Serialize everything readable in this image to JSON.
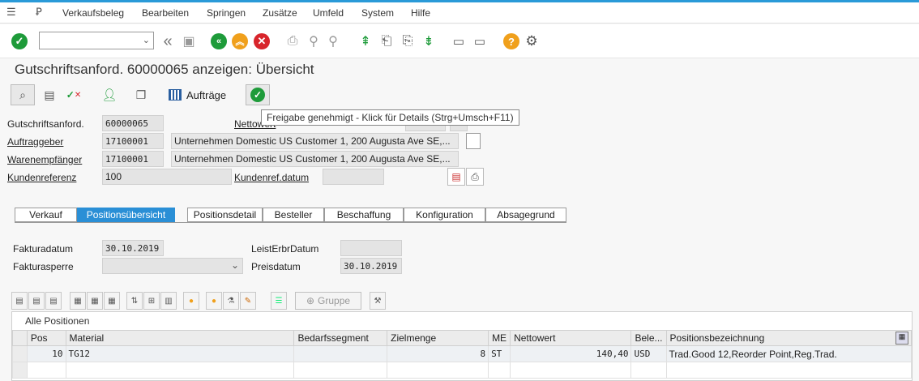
{
  "menubar": {
    "items": [
      "Verkaufsbeleg",
      "Bearbeiten",
      "Springen",
      "Zusätze",
      "Umfeld",
      "System",
      "Hilfe"
    ]
  },
  "toolbar": {
    "command_field_value": "",
    "icons": [
      "enter-icon",
      "back-arrow-icon",
      "save-icon",
      "back-icon",
      "exit-icon",
      "cancel-icon",
      "print-icon",
      "find-icon",
      "find-next-icon",
      "first-page-icon",
      "previous-page-icon",
      "next-page-icon",
      "last-page-icon",
      "new-session-icon",
      "shortcut-icon",
      "help-icon",
      "settings-icon"
    ]
  },
  "title": "Gutschriftsanford. 60000065 anzeigen: Übersicht",
  "app_toolbar": {
    "auftraege_label": "Aufträge"
  },
  "tooltip": "Freigabe genehmigt - Klick für Details   (Strg+Umsch+F11)",
  "header": {
    "gutschrift_label": "Gutschriftsanford.",
    "gutschrift_value": "60000065",
    "nettowert_label": "Nettowert",
    "auftraggeber_label": "Auftraggeber",
    "auftraggeber_value": "17100001",
    "auftraggeber_name": "Unternehmen Domestic US Customer 1, 200 Augusta Ave SE,...",
    "warenempfaenger_label": "Warenempfänger",
    "warenempfaenger_value": "17100001",
    "warenempfaenger_name": "Unternehmen Domestic US Customer 1, 200 Augusta Ave SE,...",
    "kundenreferenz_label": "Kundenreferenz",
    "kundenreferenz_value": "100",
    "kundenrefdatum_label": "Kundenref.datum",
    "kundenrefdatum_value": ""
  },
  "tabs": [
    "Verkauf",
    "Positionsübersicht",
    "Positionsdetail",
    "Besteller",
    "Beschaffung",
    "Konfiguration",
    "Absagegrund"
  ],
  "active_tab": "Positionsübersicht",
  "overview": {
    "fakturadatum_label": "Fakturadatum",
    "fakturadatum_value": "30.10.2019",
    "leisterbrdatum_label": "LeistErbrDatum",
    "leisterbrdatum_value": "",
    "fakturasperre_label": "Fakturasperre",
    "fakturasperre_value": "",
    "preisdatum_label": "Preisdatum",
    "preisdatum_value": "30.10.2019"
  },
  "grid_toolbar": {
    "gruppe_label": "Gruppe"
  },
  "items_table": {
    "title": "Alle Positionen",
    "columns": [
      "Pos",
      "Material",
      "Bedarfssegment",
      "Zielmenge",
      "ME",
      "Nettowert",
      "Bele...",
      "Positionsbezeichnung"
    ],
    "rows": [
      [
        "10",
        "TG12",
        "",
        "8",
        "ST",
        "140,40",
        "USD",
        "Trad.Good 12,Reorder Point,Reg.Trad."
      ]
    ]
  }
}
